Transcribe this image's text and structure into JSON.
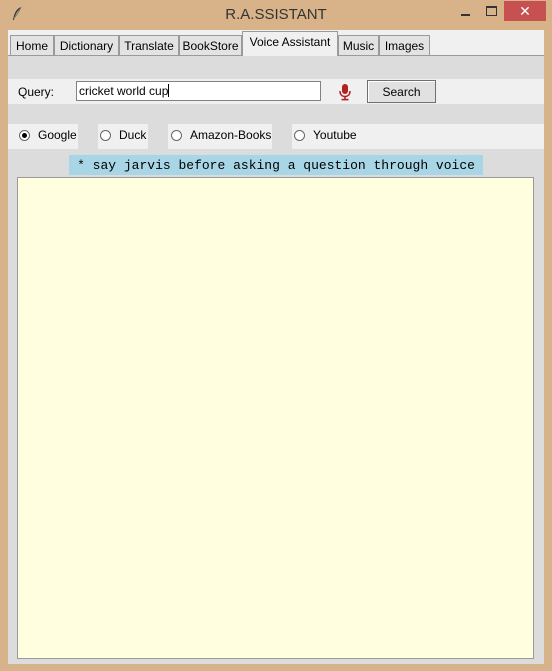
{
  "window": {
    "title": "R.A.SSISTANT",
    "close_symbol": "✕"
  },
  "tabs": [
    {
      "label": "Home"
    },
    {
      "label": "Dictionary"
    },
    {
      "label": "Translate"
    },
    {
      "label": "BookStore"
    },
    {
      "label": "Voice Assistant",
      "active": true
    },
    {
      "label": "Music"
    },
    {
      "label": "Images"
    }
  ],
  "query": {
    "label": "Query:",
    "value": "cricket world cup",
    "search_label": "Search",
    "mic_icon": "microphone-icon"
  },
  "engines": {
    "selected": "Google",
    "options": [
      "Google",
      "Duck",
      "Amazon-Books",
      "Youtube"
    ]
  },
  "hint": "* say jarvis before asking a question through voice",
  "output": {
    "text": ""
  },
  "colors": {
    "titlebar": "#d8b38a",
    "close_button": "#c75050",
    "hint_background": "#a8d6e6",
    "output_background": "#ffffe0",
    "mic": "#b22222"
  }
}
